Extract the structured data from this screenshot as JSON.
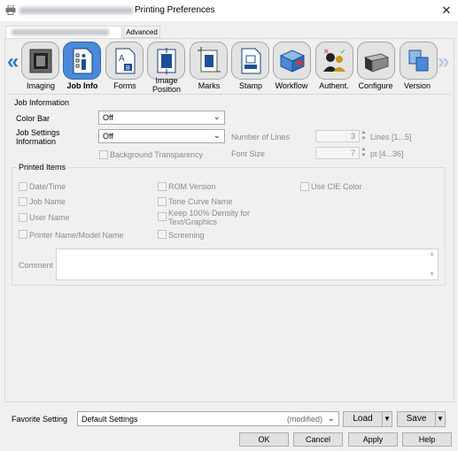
{
  "window": {
    "title": "Printing Preferences",
    "close_glyph": "✕"
  },
  "tabs": [
    {
      "label": "",
      "blurred": true
    },
    {
      "label": "Advanced",
      "selected": false
    }
  ],
  "nav": {
    "prev": "«",
    "next": "»"
  },
  "toolbar": {
    "items": [
      {
        "label": "Imaging",
        "icon": "imaging-icon"
      },
      {
        "label": "Job Info",
        "icon": "job-info-icon",
        "active": true
      },
      {
        "label": "Forms",
        "icon": "forms-icon"
      },
      {
        "label": "Image Position",
        "label_line1": "Image",
        "label_line2": "Position",
        "icon": "image-position-icon"
      },
      {
        "label": "Marks",
        "icon": "marks-icon"
      },
      {
        "label": "Stamp",
        "icon": "stamp-icon"
      },
      {
        "label": "Workflow",
        "icon": "workflow-icon"
      },
      {
        "label": "Authent.",
        "icon": "authentication-icon"
      },
      {
        "label": "Configure",
        "icon": "configure-icon"
      },
      {
        "label": "Version",
        "icon": "version-icon"
      }
    ]
  },
  "job_information": {
    "title": "Job Information",
    "color_bar": {
      "label": "Color Bar",
      "value": "Off"
    },
    "job_settings": {
      "label_line1": "Job Settings",
      "label_line2": "Information",
      "value": "Off"
    },
    "background_transparency": {
      "label": "Background Transparency",
      "checked": false
    },
    "number_of_lines": {
      "label": "Number of Lines",
      "value": "3",
      "range": "Lines [1...5]"
    },
    "font_size": {
      "label": "Font Size",
      "value": "7",
      "range": "pt [4...36]"
    }
  },
  "printed_items": {
    "title": "Printed Items",
    "col1": [
      {
        "label": "Date/Time",
        "checked": false
      },
      {
        "label": "Job Name",
        "checked": false
      },
      {
        "label": "User Name",
        "checked": false
      },
      {
        "label": "Printer Name/Model Name",
        "checked": false
      }
    ],
    "col2": [
      {
        "label": "ROM Version",
        "checked": false
      },
      {
        "label": "Tone Curve Name",
        "checked": false
      },
      {
        "label_line1": "Keep 100% Density for",
        "label_line2": "Text/Graphics",
        "checked": false
      },
      {
        "label": "Screening",
        "checked": false
      }
    ],
    "col3": [
      {
        "label": "Use CIE Color",
        "checked": false
      }
    ],
    "comment_label": "Comment",
    "comment_value": ""
  },
  "favorite": {
    "label": "Favorite Setting",
    "value": "Default Settings",
    "modified": "(modified)",
    "load": "Load",
    "save": "Save"
  },
  "footer": {
    "ok": "OK",
    "cancel": "Cancel",
    "apply": "Apply",
    "help": "Help"
  },
  "colors": {
    "accent": "#4a8ad6",
    "nav_arrow": "#3478c6"
  }
}
